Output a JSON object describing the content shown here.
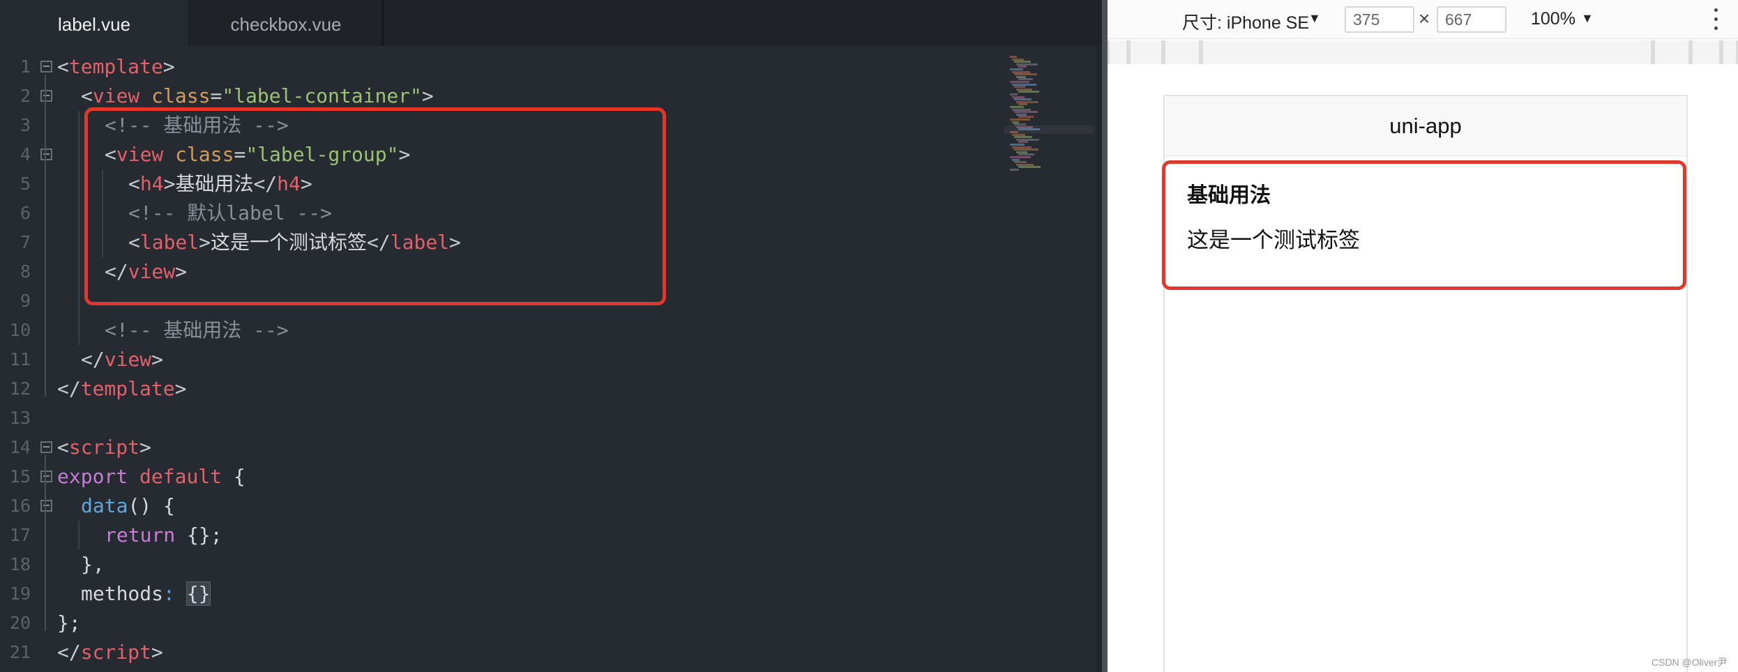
{
  "editor": {
    "tabs": [
      {
        "label": "label.vue",
        "active": true
      },
      {
        "label": "checkbox.vue",
        "active": false
      }
    ],
    "lines": [
      {
        "n": "1",
        "tokens": [
          [
            "pu",
            "<"
          ],
          [
            "tag",
            "template"
          ],
          [
            "pu",
            ">"
          ]
        ]
      },
      {
        "n": "2",
        "tokens": [
          [
            "pu",
            "<"
          ],
          [
            "tag",
            "view"
          ],
          [
            "plain",
            " "
          ],
          [
            "attr",
            "class"
          ],
          [
            "pu",
            "="
          ],
          [
            "str",
            "\"label-container\""
          ],
          [
            "pu",
            ">"
          ]
        ]
      },
      {
        "n": "3",
        "tokens": [
          [
            "com",
            "<!-- 基础用法 -->"
          ]
        ]
      },
      {
        "n": "4",
        "tokens": [
          [
            "pu",
            "<"
          ],
          [
            "tag",
            "view"
          ],
          [
            "plain",
            " "
          ],
          [
            "attr",
            "class"
          ],
          [
            "pu",
            "="
          ],
          [
            "str",
            "\"label-group\""
          ],
          [
            "pu",
            ">"
          ]
        ]
      },
      {
        "n": "5",
        "tokens": [
          [
            "pu",
            "<"
          ],
          [
            "tag",
            "h4"
          ],
          [
            "pu",
            ">"
          ],
          [
            "plain",
            "基础用法"
          ],
          [
            "pu",
            "</"
          ],
          [
            "tag",
            "h4"
          ],
          [
            "pu",
            ">"
          ]
        ]
      },
      {
        "n": "6",
        "tokens": [
          [
            "com",
            "<!-- 默认label -->"
          ]
        ]
      },
      {
        "n": "7",
        "tokens": [
          [
            "pu",
            "<"
          ],
          [
            "tag",
            "label"
          ],
          [
            "pu",
            ">"
          ],
          [
            "plain",
            "这是一个测试标签"
          ],
          [
            "pu",
            "</"
          ],
          [
            "tag",
            "label"
          ],
          [
            "pu",
            ">"
          ]
        ]
      },
      {
        "n": "8",
        "tokens": [
          [
            "pu",
            "</"
          ],
          [
            "tag",
            "view"
          ],
          [
            "pu",
            ">"
          ]
        ]
      },
      {
        "n": "9",
        "tokens": []
      },
      {
        "n": "10",
        "tokens": [
          [
            "com",
            "<!-- 基础用法 -->"
          ]
        ]
      },
      {
        "n": "11",
        "tokens": [
          [
            "pu",
            "</"
          ],
          [
            "tag",
            "view"
          ],
          [
            "pu",
            ">"
          ]
        ]
      },
      {
        "n": "12",
        "tokens": [
          [
            "pu",
            "</"
          ],
          [
            "tag",
            "template"
          ],
          [
            "pu",
            ">"
          ]
        ]
      },
      {
        "n": "13",
        "tokens": []
      },
      {
        "n": "14",
        "tokens": [
          [
            "pu",
            "<"
          ],
          [
            "tag",
            "script"
          ],
          [
            "pu",
            ">"
          ]
        ]
      },
      {
        "n": "15",
        "tokens": [
          [
            "kw",
            "export"
          ],
          [
            "plain",
            " "
          ],
          [
            "tag",
            "default"
          ],
          [
            "plain",
            " {"
          ]
        ]
      },
      {
        "n": "16",
        "tokens": [
          [
            "fn",
            "data"
          ],
          [
            "plain",
            "() {"
          ]
        ]
      },
      {
        "n": "17",
        "tokens": [
          [
            "kw",
            "return"
          ],
          [
            "plain",
            " {};"
          ]
        ]
      },
      {
        "n": "18",
        "tokens": [
          [
            "plain",
            "},"
          ]
        ]
      },
      {
        "n": "19",
        "tokens": [
          [
            "plain",
            "methods"
          ],
          [
            "fn",
            ":"
          ],
          [
            "plain",
            " "
          ],
          [
            "brk",
            "{}"
          ]
        ]
      },
      {
        "n": "20",
        "tokens": [
          [
            "plain",
            "};"
          ]
        ]
      },
      {
        "n": "21",
        "tokens": [
          [
            "pu",
            "</"
          ],
          [
            "tag",
            "script"
          ],
          [
            "pu",
            ">"
          ]
        ]
      }
    ]
  },
  "preview": {
    "device_label": "尺寸: iPhone SE",
    "width_value": "375",
    "times_symbol": "×",
    "height_value": "667",
    "zoom_label": "100%",
    "nav_title": "uni-app",
    "heading": "基础用法",
    "label_text": "这是一个测试标签"
  },
  "watermark": "CSDN @Oliver尹",
  "colors": {
    "highlight": "#e1382b",
    "tag": "#e2616a",
    "attr": "#d49c5a",
    "string": "#9bc373",
    "comment": "#8a8e96",
    "keyword": "#c77dd8",
    "function": "#5fa8dc"
  }
}
